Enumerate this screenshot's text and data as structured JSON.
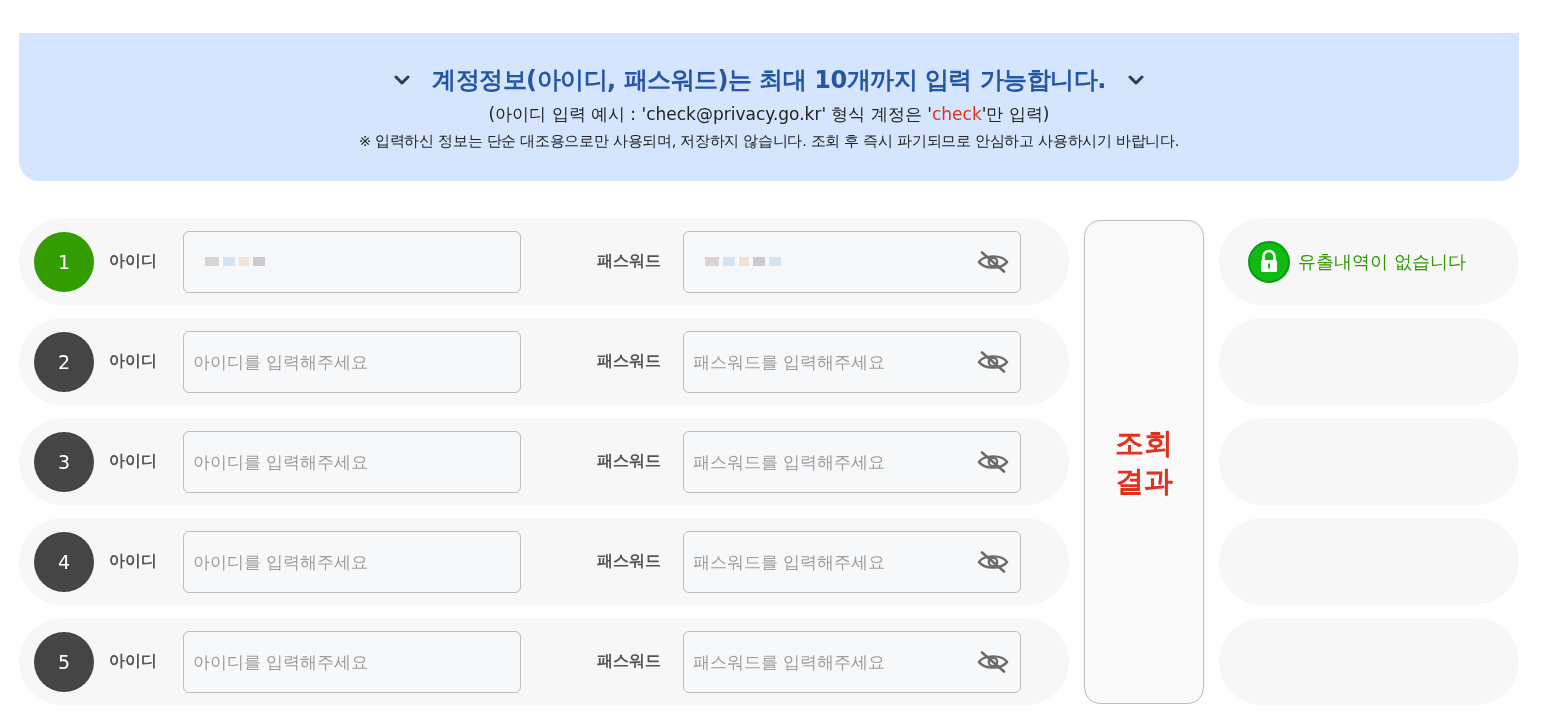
{
  "notice": {
    "title": "계정정보(아이디, 패스워드)는 최대 10개까지 입력 가능합니다.",
    "example": {
      "before": "(아이디 입력 예시 : 'check@privacy.go.kr' 형식 계정은 '",
      "highlight": "check",
      "after": "'만 입력)"
    },
    "disclaimer": "※ 입력하신 정보는 단순 대조용으로만 사용되며, 저장하지 않습니다. 조회 후 즉시 파기되므로 안심하고 사용하시기 바랍니다."
  },
  "rows": [
    {
      "number": "1",
      "safe": true,
      "id_label": "아이디",
      "pw_label": "패스워드",
      "redacted": true,
      "result": "유출내역이 없습니다"
    },
    {
      "number": "2",
      "safe": false,
      "id_label": "아이디",
      "pw_label": "패스워드",
      "redacted": false,
      "id_placeholder": "아이디를 입력해주세요",
      "pw_placeholder": "패스워드를 입력해주세요"
    },
    {
      "number": "3",
      "safe": false,
      "id_label": "아이디",
      "pw_label": "패스워드",
      "redacted": false,
      "id_placeholder": "아이디를 입력해주세요",
      "pw_placeholder": "패스워드를 입력해주세요"
    },
    {
      "number": "4",
      "safe": false,
      "id_label": "아이디",
      "pw_label": "패스워드",
      "redacted": false,
      "id_placeholder": "아이디를 입력해주세요",
      "pw_placeholder": "패스워드를 입력해주세요"
    },
    {
      "number": "5",
      "safe": false,
      "id_label": "아이디",
      "pw_label": "패스워드",
      "redacted": false,
      "id_placeholder": "아이디를 입력해주세요",
      "pw_placeholder": "패스워드를 입력해주세요"
    }
  ],
  "search_button": {
    "label": "조회 결과"
  }
}
